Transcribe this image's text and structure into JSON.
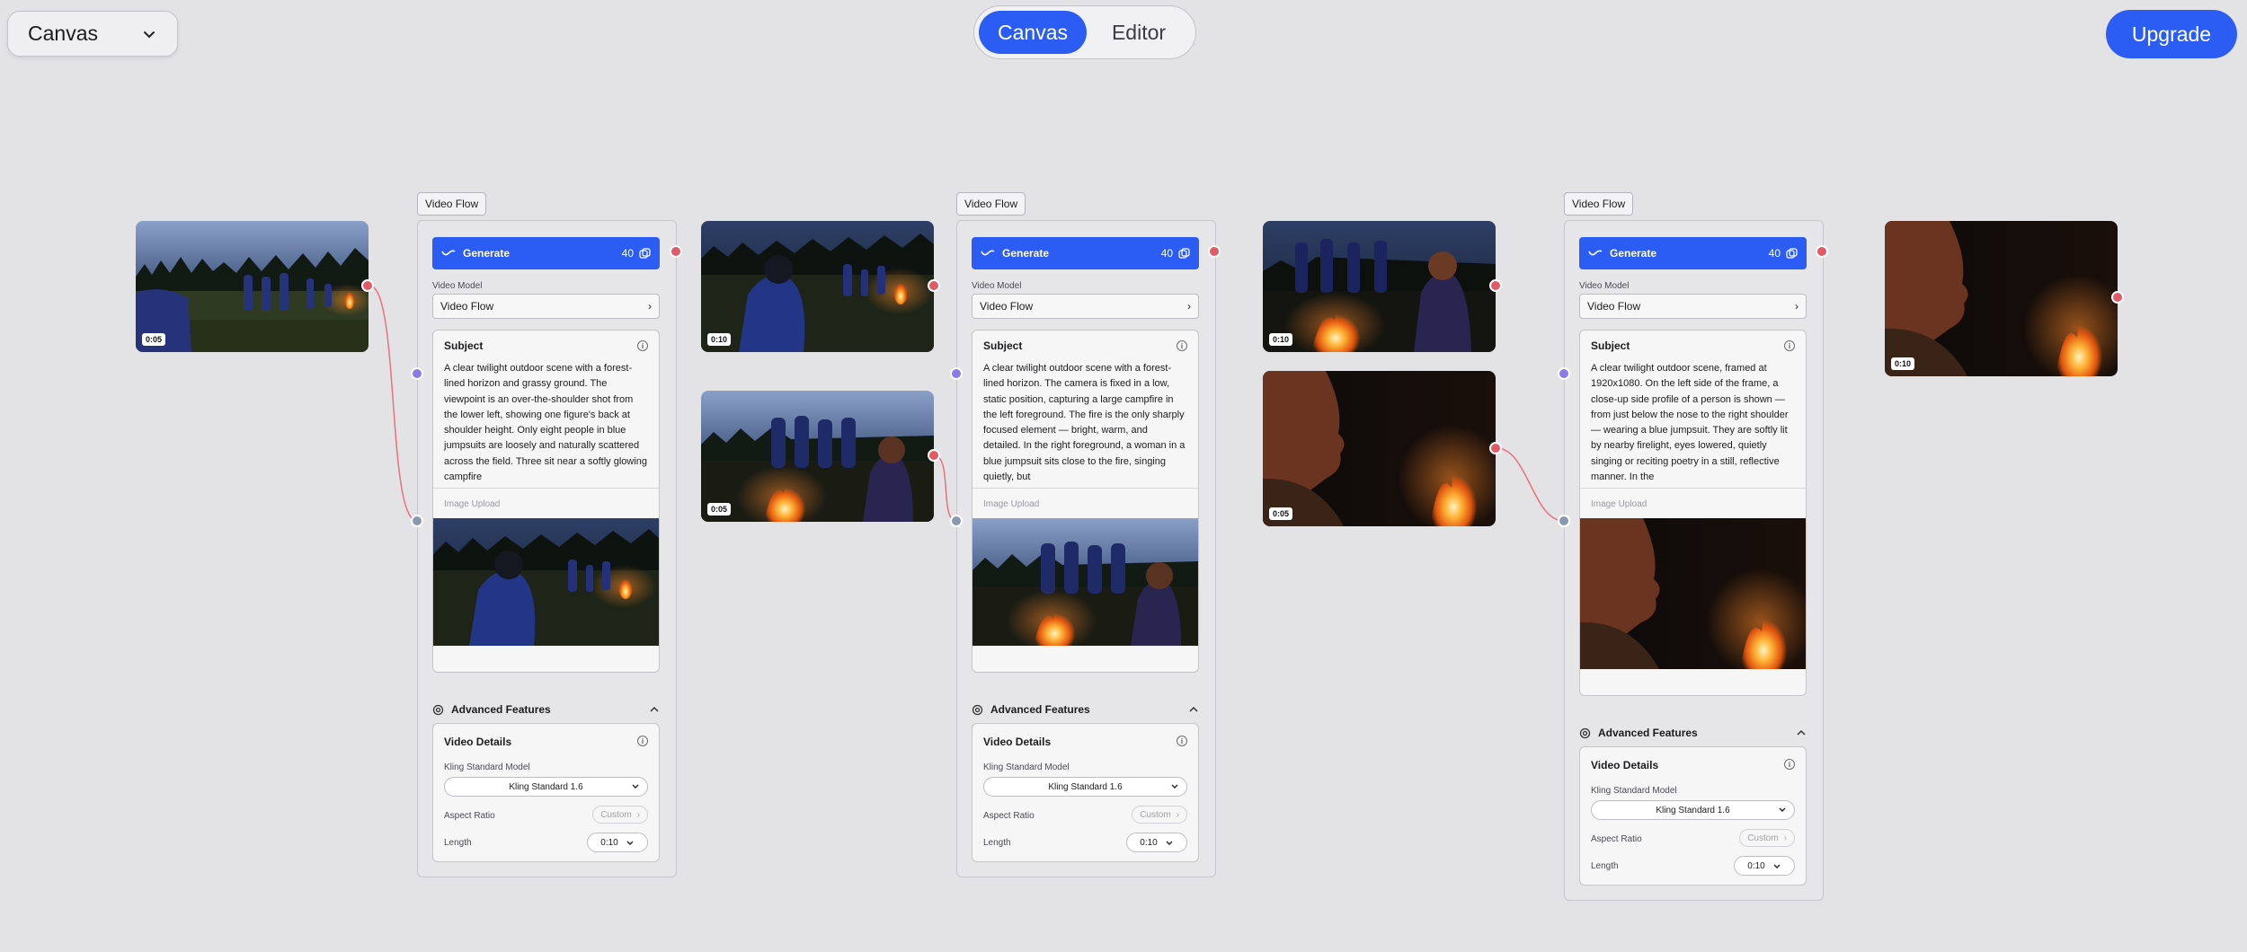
{
  "header": {
    "canvas_select": "Canvas",
    "tabs": [
      "Canvas",
      "Editor"
    ],
    "upgrade": "Upgrade"
  },
  "images": {
    "a": "0:05",
    "b": "0:10",
    "c": "0:05",
    "d": "0:10",
    "e": "0:05",
    "f": "0:10"
  },
  "flows": [
    {
      "tag": "Video Flow",
      "generate": "Generate",
      "credits": "40",
      "video_model_label": "Video Model",
      "video_model": "Video Flow",
      "subject_label": "Subject",
      "subject_text": "A clear twilight outdoor scene with a forest-lined horizon and grassy ground. The viewpoint is an over-the-shoulder shot from the lower left, showing one figure's back at shoulder height. Only eight people in blue jumpsuits are loosely and naturally scattered across the field. Three sit near a softly glowing campfire",
      "image_upload": "Image Upload",
      "advanced": "Advanced Features",
      "video_details": "Video Details",
      "model_label": "Kling Standard Model",
      "model_value": "Kling Standard 1.6",
      "aspect_label": "Aspect Ratio",
      "aspect_value": "Custom",
      "length_label": "Length",
      "length_value": "0:10"
    },
    {
      "tag": "Video Flow",
      "generate": "Generate",
      "credits": "40",
      "video_model_label": "Video Model",
      "video_model": "Video Flow",
      "subject_label": "Subject",
      "subject_text": "A clear twilight outdoor scene with a forest-lined horizon. The camera is fixed in a low, static position, capturing a large campfire in the left foreground. The fire is the only sharply focused element — bright, warm, and detailed. In the right foreground, a woman in a blue jumpsuit sits close to the fire, singing quietly, but",
      "image_upload": "Image Upload",
      "advanced": "Advanced Features",
      "video_details": "Video Details",
      "model_label": "Kling Standard Model",
      "model_value": "Kling Standard 1.6",
      "aspect_label": "Aspect Ratio",
      "aspect_value": "Custom",
      "length_label": "Length",
      "length_value": "0:10"
    },
    {
      "tag": "Video Flow",
      "generate": "Generate",
      "credits": "40",
      "video_model_label": "Video Model",
      "video_model": "Video Flow",
      "subject_label": "Subject",
      "subject_text": "A clear twilight outdoor scene, framed at 1920x1080. On the left side of the frame, a close-up side profile of a person is shown — from just below the nose to the right shoulder — wearing a blue jumpsuit. They are softly lit by nearby firelight, eyes lowered, quietly singing or reciting poetry in a still, reflective manner. In the",
      "image_upload": "Image Upload",
      "advanced": "Advanced Features",
      "video_details": "Video Details",
      "model_label": "Kling Standard Model",
      "model_value": "Kling Standard 1.6",
      "aspect_label": "Aspect Ratio",
      "aspect_value": "Custom",
      "length_label": "Length",
      "length_value": "0:10"
    }
  ],
  "colors": {
    "accent": "#2b5df5",
    "port_out": "#e05b67",
    "port_in_top": "#8c7ae6",
    "port_in_image": "#8a98b0",
    "edge": "#e9707c"
  }
}
